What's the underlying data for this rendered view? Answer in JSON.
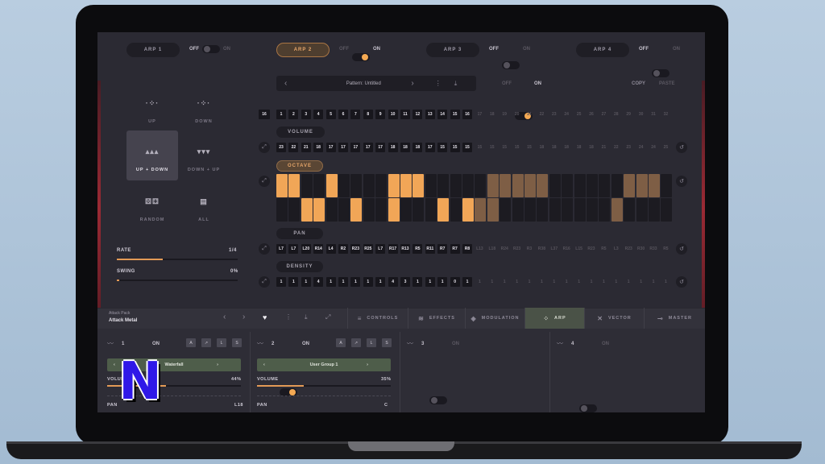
{
  "arp_tabs": [
    {
      "label": "ARP 1",
      "state_off": "OFF",
      "state_on": "ON",
      "on": false
    },
    {
      "label": "ARP 2",
      "state_off": "OFF",
      "state_on": "ON",
      "on": true
    },
    {
      "label": "ARP 3",
      "state_off": "OFF",
      "state_on": "ON",
      "on": false
    },
    {
      "label": "ARP 4",
      "state_off": "OFF",
      "state_on": "ON",
      "on": false
    }
  ],
  "pattern": {
    "name": "Pattern: Untitled",
    "toggle_off": "OFF",
    "toggle_on": "ON",
    "copy": "COPY",
    "paste": "PASTE"
  },
  "modes": [
    {
      "label": "UP",
      "icon": "up-icon"
    },
    {
      "label": "DOWN",
      "icon": "down-icon"
    },
    {
      "label": "UP + DOWN",
      "icon": "up-down-icon",
      "active": true
    },
    {
      "label": "DOWN + UP",
      "icon": "down-up-icon"
    },
    {
      "label": "RANDOM",
      "icon": "dice-icon"
    },
    {
      "label": "ALL",
      "icon": "keys-icon"
    }
  ],
  "rate": {
    "label": "RATE",
    "value": "1/4",
    "level": 0.38
  },
  "swing": {
    "label": "SWING",
    "value": "0%",
    "level": 0.02
  },
  "steps": {
    "count_label": "16",
    "numbers": [
      "1",
      "2",
      "3",
      "4",
      "5",
      "6",
      "7",
      "8",
      "9",
      "10",
      "11",
      "12",
      "13",
      "14",
      "15",
      "16",
      "17",
      "18",
      "19",
      "20",
      "21",
      "22",
      "23",
      "24",
      "25",
      "26",
      "27",
      "28",
      "29",
      "30",
      "31",
      "32"
    ],
    "active_count": 16
  },
  "sections": {
    "volume": "VOLUME",
    "octave": "OCTAVE",
    "pan": "PAN",
    "density": "DENSITY"
  },
  "volume_values": [
    "23",
    "22",
    "21",
    "18",
    "17",
    "17",
    "17",
    "17",
    "17",
    "18",
    "18",
    "18",
    "17",
    "15",
    "15",
    "15",
    "15",
    "15",
    "15",
    "15",
    "15",
    "18",
    "18",
    "18",
    "18",
    "18",
    "21",
    "22",
    "23",
    "24",
    "24",
    "25"
  ],
  "octave_top": [
    1,
    1,
    0,
    0,
    1,
    0,
    0,
    0,
    0,
    1,
    1,
    1,
    0,
    0,
    0,
    0,
    0,
    2,
    2,
    2,
    2,
    2,
    0,
    0,
    0,
    0,
    0,
    0,
    2,
    2,
    2,
    0
  ],
  "octave_bottom": [
    0,
    0,
    1,
    1,
    0,
    0,
    1,
    0,
    0,
    1,
    0,
    0,
    0,
    1,
    0,
    1,
    2,
    2,
    0,
    0,
    0,
    0,
    0,
    0,
    0,
    0,
    0,
    2,
    0,
    0,
    0,
    0
  ],
  "pan_values": [
    "L7",
    "L7",
    "L20",
    "R14",
    "L4",
    "R2",
    "R23",
    "R25",
    "L7",
    "R17",
    "R13",
    "R5",
    "R11",
    "R7",
    "R7",
    "R8",
    "L13",
    "L18",
    "R24",
    "R23",
    "R3",
    "R38",
    "L37",
    "R16",
    "L15",
    "R23",
    "R5",
    "L3",
    "R23",
    "R30",
    "R33",
    "R5"
  ],
  "density_values": [
    "1",
    "1",
    "1",
    "4",
    "1",
    "1",
    "1",
    "1",
    "1",
    "4",
    "3",
    "1",
    "1",
    "1",
    "0",
    "1",
    "1",
    "1",
    "1",
    "1",
    "1",
    "1",
    "1",
    "1",
    "1",
    "1",
    "1",
    "1",
    "1",
    "1",
    "1",
    "1"
  ],
  "preset": {
    "pack": "Attack Pack",
    "name": "Attack Metal"
  },
  "nav_tabs": [
    {
      "label": "CONTROLS",
      "icon": "sliders-icon"
    },
    {
      "label": "EFFECTS",
      "icon": "wave-icon"
    },
    {
      "label": "MODULATION",
      "icon": "mod-icon"
    },
    {
      "label": "ARP",
      "icon": "arp-icon",
      "active": true
    },
    {
      "label": "VECTOR",
      "icon": "vector-icon"
    },
    {
      "label": "MASTER",
      "icon": "master-icon"
    }
  ],
  "bottom_groups": [
    {
      "num": "1",
      "on_label": "ON",
      "on": true,
      "preset": "Waterfall",
      "volume_label": "VOLUME",
      "volume_value": "44%",
      "pan_label": "PAN",
      "pan_value": "L18",
      "buttons": [
        "A",
        "↗",
        "L",
        "S"
      ]
    },
    {
      "num": "2",
      "on_label": "ON",
      "on": true,
      "preset": "User Group 1",
      "volume_label": "VOLUME",
      "volume_value": "35%",
      "pan_label": "PAN",
      "pan_value": "C",
      "buttons": [
        "A",
        "↗",
        "L",
        "S"
      ]
    },
    {
      "num": "3",
      "on_label": "ON",
      "on": false
    },
    {
      "num": "4",
      "on_label": "ON",
      "on": false
    }
  ],
  "logo": "N",
  "colors": {
    "accent": "#f1a657",
    "panel": "#2b2a33",
    "cell": "#17161c",
    "active_nav": "#4a5247"
  }
}
